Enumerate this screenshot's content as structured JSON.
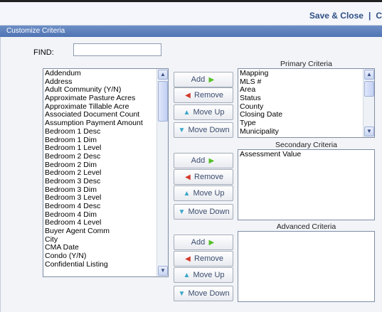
{
  "toolbar": {
    "save_close": "Save & Close",
    "separator": "|",
    "next_label": "C"
  },
  "window": {
    "title": "Customize Criteria"
  },
  "find": {
    "label": "FIND:",
    "value": ""
  },
  "available_fields": [
    "Addendum",
    "Address",
    "Adult Community (Y/N)",
    "Approximate Pasture Acres",
    "Approximate Tillable Acre",
    "Associated Document Count",
    "Assumption Payment Amount",
    "Bedroom 1 Desc",
    "Bedroom 1 Dim",
    "Bedroom 1 Level",
    "Bedroom 2 Desc",
    "Bedroom 2 Dim",
    "Bedroom 2 Level",
    "Bedroom 3 Desc",
    "Bedroom 3 Dim",
    "Bedroom 3 Level",
    "Bedroom 4 Desc",
    "Bedroom 4 Dim",
    "Bedroom 4 Level",
    "Buyer Agent Comm",
    "City",
    "CMA Date",
    "Condo (Y/N)",
    "Confidential Listing"
  ],
  "buttons": {
    "add": "Add",
    "remove": "Remove",
    "move_up": "Move Up",
    "move_down": "Move Down"
  },
  "primary": {
    "label": "Primary Criteria",
    "items": [
      "Mapping",
      "MLS #",
      "Area",
      "Status",
      "County",
      "Closing Date",
      "Type",
      "Municipality"
    ]
  },
  "secondary": {
    "label": "Secondary Criteria",
    "items": [
      "Assessment Value"
    ]
  },
  "advanced": {
    "label": "Advanced Criteria",
    "items": []
  },
  "colors": {
    "titlebar": "#5a7dba",
    "link": "#2f4f84",
    "add_arrow": "#55c027",
    "remove_arrow": "#d43a2a",
    "move_arrow": "#3aa6c8"
  }
}
